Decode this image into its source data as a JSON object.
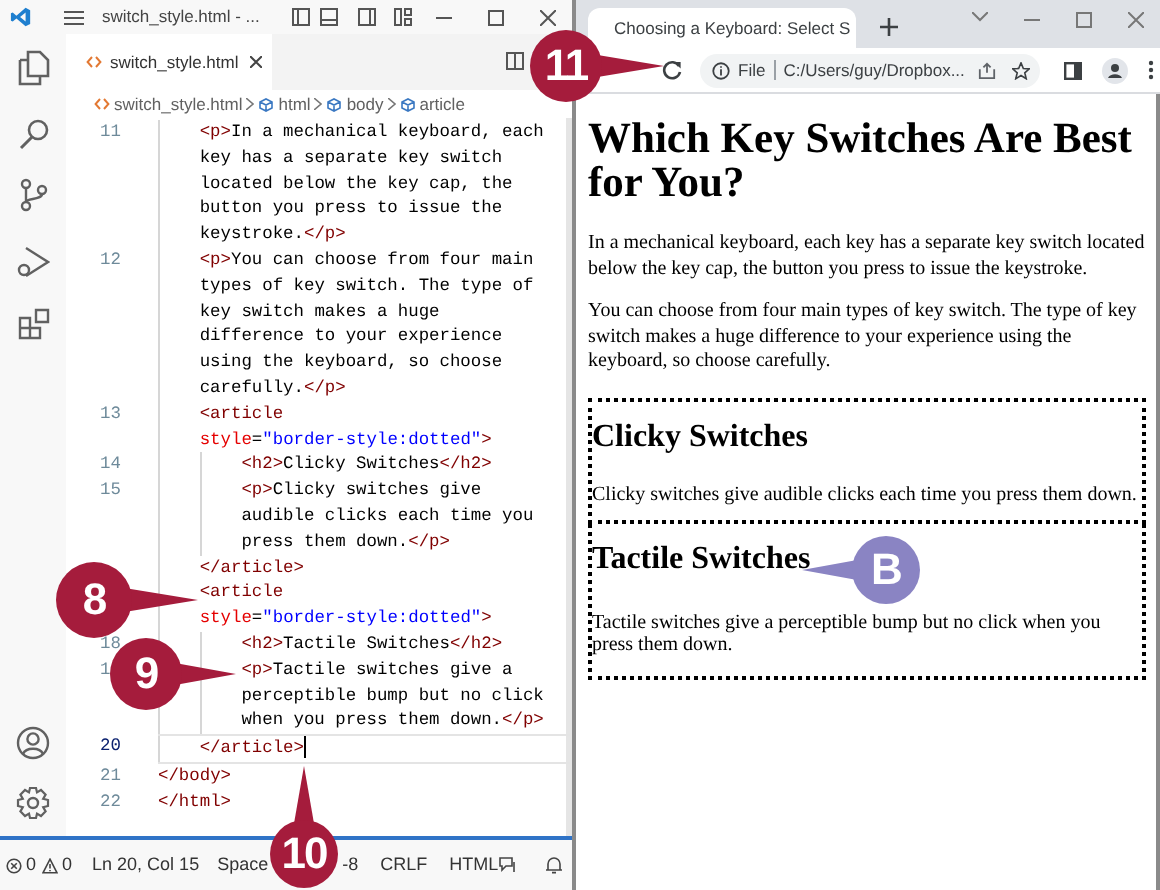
{
  "editor": {
    "title": "switch_style.html - ...",
    "tab": {
      "label": "switch_style.html",
      "selected": true
    },
    "breadcrumbs": [
      {
        "label": "switch_style.html",
        "kind": "file"
      },
      {
        "label": "html",
        "kind": "element"
      },
      {
        "label": "body",
        "kind": "element"
      },
      {
        "label": "article",
        "kind": "element"
      }
    ],
    "lines": [
      {
        "children": [
          {
            "number": "11",
            "segments": [
              {
                "kind": "tag",
                "text": "<p>"
              },
              {
                "kind": "text",
                "text": "In a mechanical keyboard, each key has a separate key switch located below the key cap, the button you press to issue the keystroke."
              },
              {
                "kind": "tag",
                "text": "</p>"
              }
            ]
          },
          {
            "number": "12",
            "segments": [
              {
                "kind": "tag",
                "text": "<p>"
              },
              {
                "kind": "text",
                "text": "You can choose from four main types of key switch. The type of key switch makes a huge difference to your experience using the keyboard, so choose carefully."
              },
              {
                "kind": "tag",
                "text": "</p>"
              }
            ]
          },
          {
            "number": "13",
            "segments": [
              {
                "kind": "tag",
                "text": "<article "
              },
              {
                "kind": "attr",
                "text": "style"
              },
              {
                "kind": "text",
                "text": "="
              },
              {
                "kind": "value",
                "text": "\"border-style:dotted\""
              },
              {
                "kind": "tag",
                "text": ">"
              }
            ],
            "children": [
              {
                "number": "14",
                "segments": [
                  {
                    "kind": "tag",
                    "text": "<h2>"
                  },
                  {
                    "kind": "text",
                    "text": "Clicky Switches"
                  },
                  {
                    "kind": "tag",
                    "text": "</h2>"
                  }
                ]
              },
              {
                "number": "15",
                "segments": [
                  {
                    "kind": "tag",
                    "text": "<p>"
                  },
                  {
                    "kind": "text",
                    "text": "Clicky switches give audible clicks each time you press them down."
                  },
                  {
                    "kind": "tag",
                    "text": "</p>"
                  }
                ]
              }
            ]
          },
          {
            "segments": [
              {
                "kind": "tag",
                "text": "</article>"
              }
            ]
          },
          {
            "segments": [
              {
                "kind": "tag",
                "text": "<article "
              },
              {
                "kind": "attr",
                "text": "style"
              },
              {
                "kind": "text",
                "text": "="
              },
              {
                "kind": "value",
                "text": "\"border-style:dotted\""
              },
              {
                "kind": "tag",
                "text": ">"
              }
            ],
            "children": [
              {
                "number": "18",
                "segments": [
                  {
                    "kind": "tag",
                    "text": "<h2>"
                  },
                  {
                    "kind": "text",
                    "text": "Tactile Switches"
                  },
                  {
                    "kind": "tag",
                    "text": "</h2>"
                  }
                ]
              },
              {
                "number": "1",
                "segments": [
                  {
                    "kind": "tag",
                    "text": "<p>"
                  },
                  {
                    "kind": "text",
                    "text": "Tactile switches give a perceptible bump but no click when you press them down."
                  },
                  {
                    "kind": "tag",
                    "text": "</p>"
                  }
                ]
              }
            ]
          },
          {
            "number": "20",
            "current": true,
            "segments": [
              {
                "kind": "tag",
                "text": "</article>"
              }
            ]
          }
        ]
      },
      {
        "number": "21",
        "segments": [
          {
            "kind": "tag",
            "text": "</body>"
          }
        ]
      },
      {
        "number": "22",
        "segments": [
          {
            "kind": "tag",
            "text": "</html>"
          }
        ]
      }
    ],
    "status_bar": {
      "errors": "0",
      "warnings": "0",
      "position": "Ln 20, Col 15",
      "items": [
        "Space",
        "-8",
        "CRLF",
        "HTML"
      ]
    }
  },
  "browser": {
    "tab": {
      "title": "Choosing a Keyboard: Select S",
      "selected": true
    },
    "address": {
      "scheme": "File",
      "url": "C:/Users/guy/Dropbox..."
    },
    "page": {
      "heading": "Which Key Switches Are Best for You?",
      "paragraphs": [
        "In a mechanical keyboard, each key has a separate key switch located below the key cap, the button you press to issue the keystroke.",
        "You can choose from four main types of key switch. The type of key switch makes a huge difference to your experience using the keyboard, so choose carefully."
      ],
      "articles": [
        {
          "heading": "Clicky Switches",
          "text": "Clicky switches give audible clicks each time you press them down."
        },
        {
          "heading": "Tactile Switches",
          "text": "Tactile switches give a perceptible bump but no click when you press them down."
        }
      ]
    }
  },
  "callouts": [
    {
      "label": "11",
      "color": "#a51c3c"
    },
    {
      "label": "8",
      "color": "#a51c3c"
    },
    {
      "label": "B",
      "color": "#8a84c3"
    },
    {
      "label": "9",
      "color": "#a51c3c"
    },
    {
      "label": "10",
      "color": "#a51c3c"
    }
  ]
}
